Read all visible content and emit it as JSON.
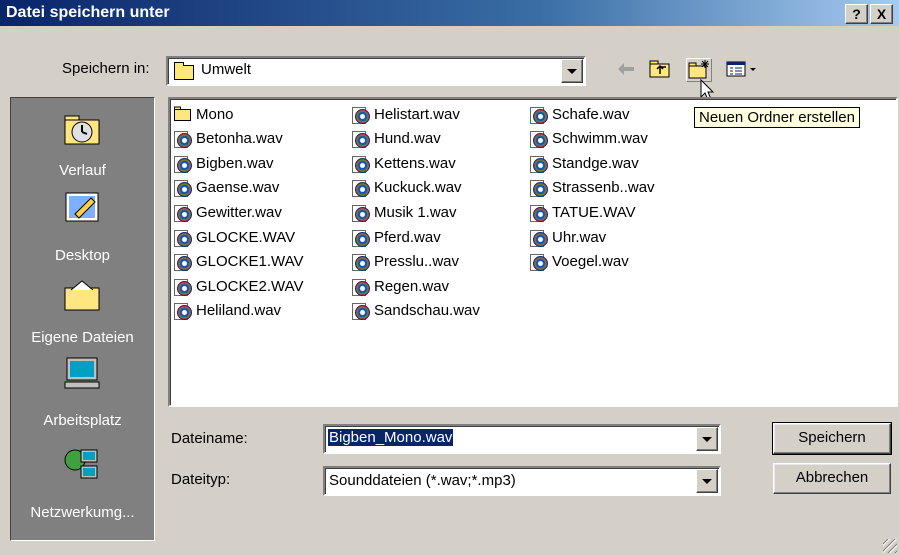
{
  "window": {
    "title": "Datei speichern unter",
    "help_btn": "?",
    "close_btn": "X"
  },
  "savein": {
    "label": "Speichern in:",
    "value": "Umwelt"
  },
  "toolbar": {
    "tooltip": "Neuen Ordner erstellen"
  },
  "places": [
    {
      "label": "Verlauf",
      "icon": "history-icon"
    },
    {
      "label": "Desktop",
      "icon": "desktop-icon"
    },
    {
      "label": "Eigene Dateien",
      "icon": "my-documents-icon"
    },
    {
      "label": "Arbeitsplatz",
      "icon": "my-computer-icon"
    },
    {
      "label": "Netzwerkumg...",
      "icon": "network-icon"
    }
  ],
  "files": {
    "col1": [
      "Mono",
      "Betonha.wav",
      "Bigben.wav",
      "Gaense.wav",
      "Gewitter.wav",
      "GLOCKE.WAV",
      "GLOCKE1.WAV",
      "GLOCKE2.WAV",
      "Heliland.wav"
    ],
    "col2": [
      "Helistart.wav",
      "Hund.wav",
      "Kettens.wav",
      "Kuckuck.wav",
      "Musik 1.wav",
      "Pferd.wav",
      "Presslu..wav",
      "Regen.wav",
      "Sandschau.wav"
    ],
    "col3": [
      "Schafe.wav",
      "Schwimm.wav",
      "Standge.wav",
      "Strassenb..wav",
      "TATUE.WAV",
      "Uhr.wav",
      "Voegel.wav"
    ]
  },
  "filename": {
    "label": "Dateiname:",
    "value": "Bigben_Mono.wav"
  },
  "filetype": {
    "label": "Dateityp:",
    "value": "Sounddateien (*.wav;*.mp3)"
  },
  "buttons": {
    "save": "Speichern",
    "cancel": "Abbrechen"
  }
}
